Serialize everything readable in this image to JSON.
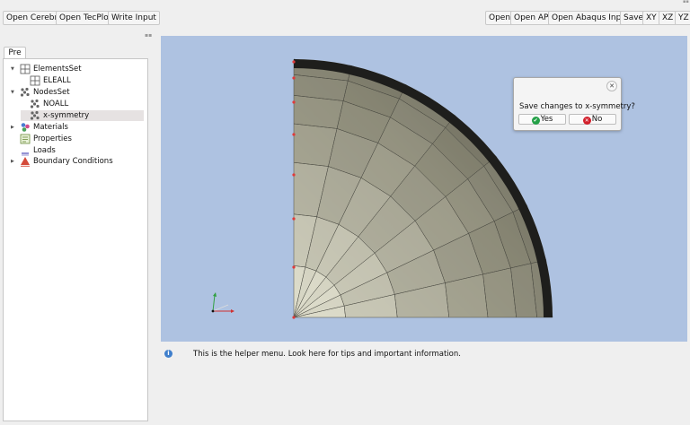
{
  "toolbar_left": [
    "Open Cerebro",
    "Open TecPlot",
    "Write Input"
  ],
  "toolbar_right": [
    "Open",
    "Open API",
    "Open Abaqus Input",
    "Save",
    "XY",
    "XZ",
    "YZ"
  ],
  "tab": {
    "label": "Pre"
  },
  "tree": {
    "items": [
      {
        "label": "ElementsSet",
        "icon": "grid-icon",
        "expanded": true
      },
      {
        "label": "ELEALL",
        "icon": "grid-icon"
      },
      {
        "label": "NodesSet",
        "icon": "nodes-icon",
        "expanded": true
      },
      {
        "label": "NOALL",
        "icon": "nodes-icon"
      },
      {
        "label": "x-symmetry",
        "icon": "nodes-icon",
        "selected": true
      },
      {
        "label": "Materials",
        "icon": "materials-icon",
        "expanded": false
      },
      {
        "label": "Properties",
        "icon": "properties-icon"
      },
      {
        "label": "Loads",
        "icon": "loads-icon"
      },
      {
        "label": "Boundary Conditions",
        "icon": "boundary-icon",
        "expanded": false
      }
    ]
  },
  "helper": {
    "text": "This is the helper menu. Look here for tips and important information."
  },
  "dialog": {
    "message": "Save changes to x-symmetry?",
    "yes_label": "Yes",
    "no_label": "No"
  },
  "colors": {
    "viewport": "#aec2e1",
    "selected_row": "#e6e2e2",
    "dialog_yes": "#23a047",
    "dialog_no": "#d21f2b"
  }
}
